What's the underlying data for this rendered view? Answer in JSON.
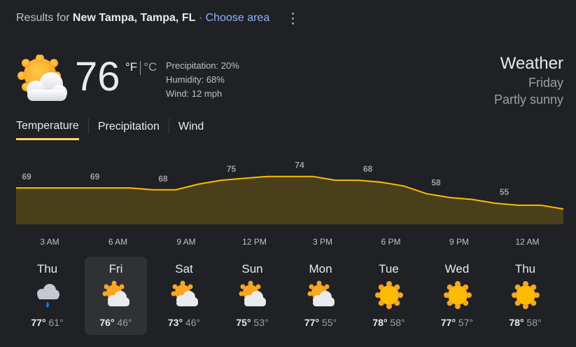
{
  "header": {
    "results_prefix": "Results for",
    "location": "New Tampa, Tampa, FL",
    "separator": "·",
    "choose_area": "Choose area"
  },
  "current": {
    "icon": "partly-sunny-icon",
    "temperature": "76",
    "unit_f": "°F",
    "unit_c": "°C",
    "precipitation": "Precipitation: 20%",
    "humidity": "Humidity: 68%",
    "wind": "Wind: 12 mph"
  },
  "summary": {
    "title": "Weather",
    "day": "Friday",
    "condition": "Partly sunny"
  },
  "tabs": [
    {
      "label": "Temperature",
      "active": true
    },
    {
      "label": "Precipitation",
      "active": false
    },
    {
      "label": "Wind",
      "active": false
    }
  ],
  "colors": {
    "accent": "#fdd663",
    "line": "#fbbc04",
    "area_fill": "#4a3f1b",
    "link": "#8ab4f8",
    "background": "#202124"
  },
  "chart_data": {
    "type": "area",
    "tick_labels": [
      "3 AM",
      "6 AM",
      "9 AM",
      "12 PM",
      "3 PM",
      "6 PM",
      "9 PM",
      "12 AM"
    ],
    "labeled_values": [
      69,
      69,
      68,
      75,
      74,
      68,
      58,
      55
    ],
    "series": [
      {
        "x": [
          0,
          1,
          2,
          3,
          4,
          5,
          6,
          7,
          8,
          9,
          10,
          11,
          12,
          13,
          14,
          15,
          16,
          17,
          18,
          19,
          20,
          21,
          22,
          23,
          24
        ],
        "values": [
          69,
          69,
          69,
          69,
          69,
          69,
          68,
          68,
          71,
          73,
          74,
          75,
          75,
          75,
          73,
          73,
          72,
          70,
          66,
          64,
          63,
          61,
          60,
          60,
          58
        ]
      }
    ],
    "ylim": [
      50,
      80
    ],
    "grid": false
  },
  "forecast": [
    {
      "day": "Thu",
      "icon": "showers-icon",
      "high": "77°",
      "low": "61°",
      "selected": false
    },
    {
      "day": "Fri",
      "icon": "partly-sunny-icon",
      "high": "76°",
      "low": "46°",
      "selected": true
    },
    {
      "day": "Sat",
      "icon": "partly-sunny-icon",
      "high": "73°",
      "low": "46°",
      "selected": false
    },
    {
      "day": "Sun",
      "icon": "partly-sunny-icon",
      "high": "75°",
      "low": "53°",
      "selected": false
    },
    {
      "day": "Mon",
      "icon": "partly-sunny-icon",
      "high": "77°",
      "low": "55°",
      "selected": false
    },
    {
      "day": "Tue",
      "icon": "sunny-icon",
      "high": "78°",
      "low": "58°",
      "selected": false
    },
    {
      "day": "Wed",
      "icon": "sunny-icon",
      "high": "77°",
      "low": "57°",
      "selected": false
    },
    {
      "day": "Thu",
      "icon": "sunny-icon",
      "high": "78°",
      "low": "58°",
      "selected": false
    }
  ]
}
